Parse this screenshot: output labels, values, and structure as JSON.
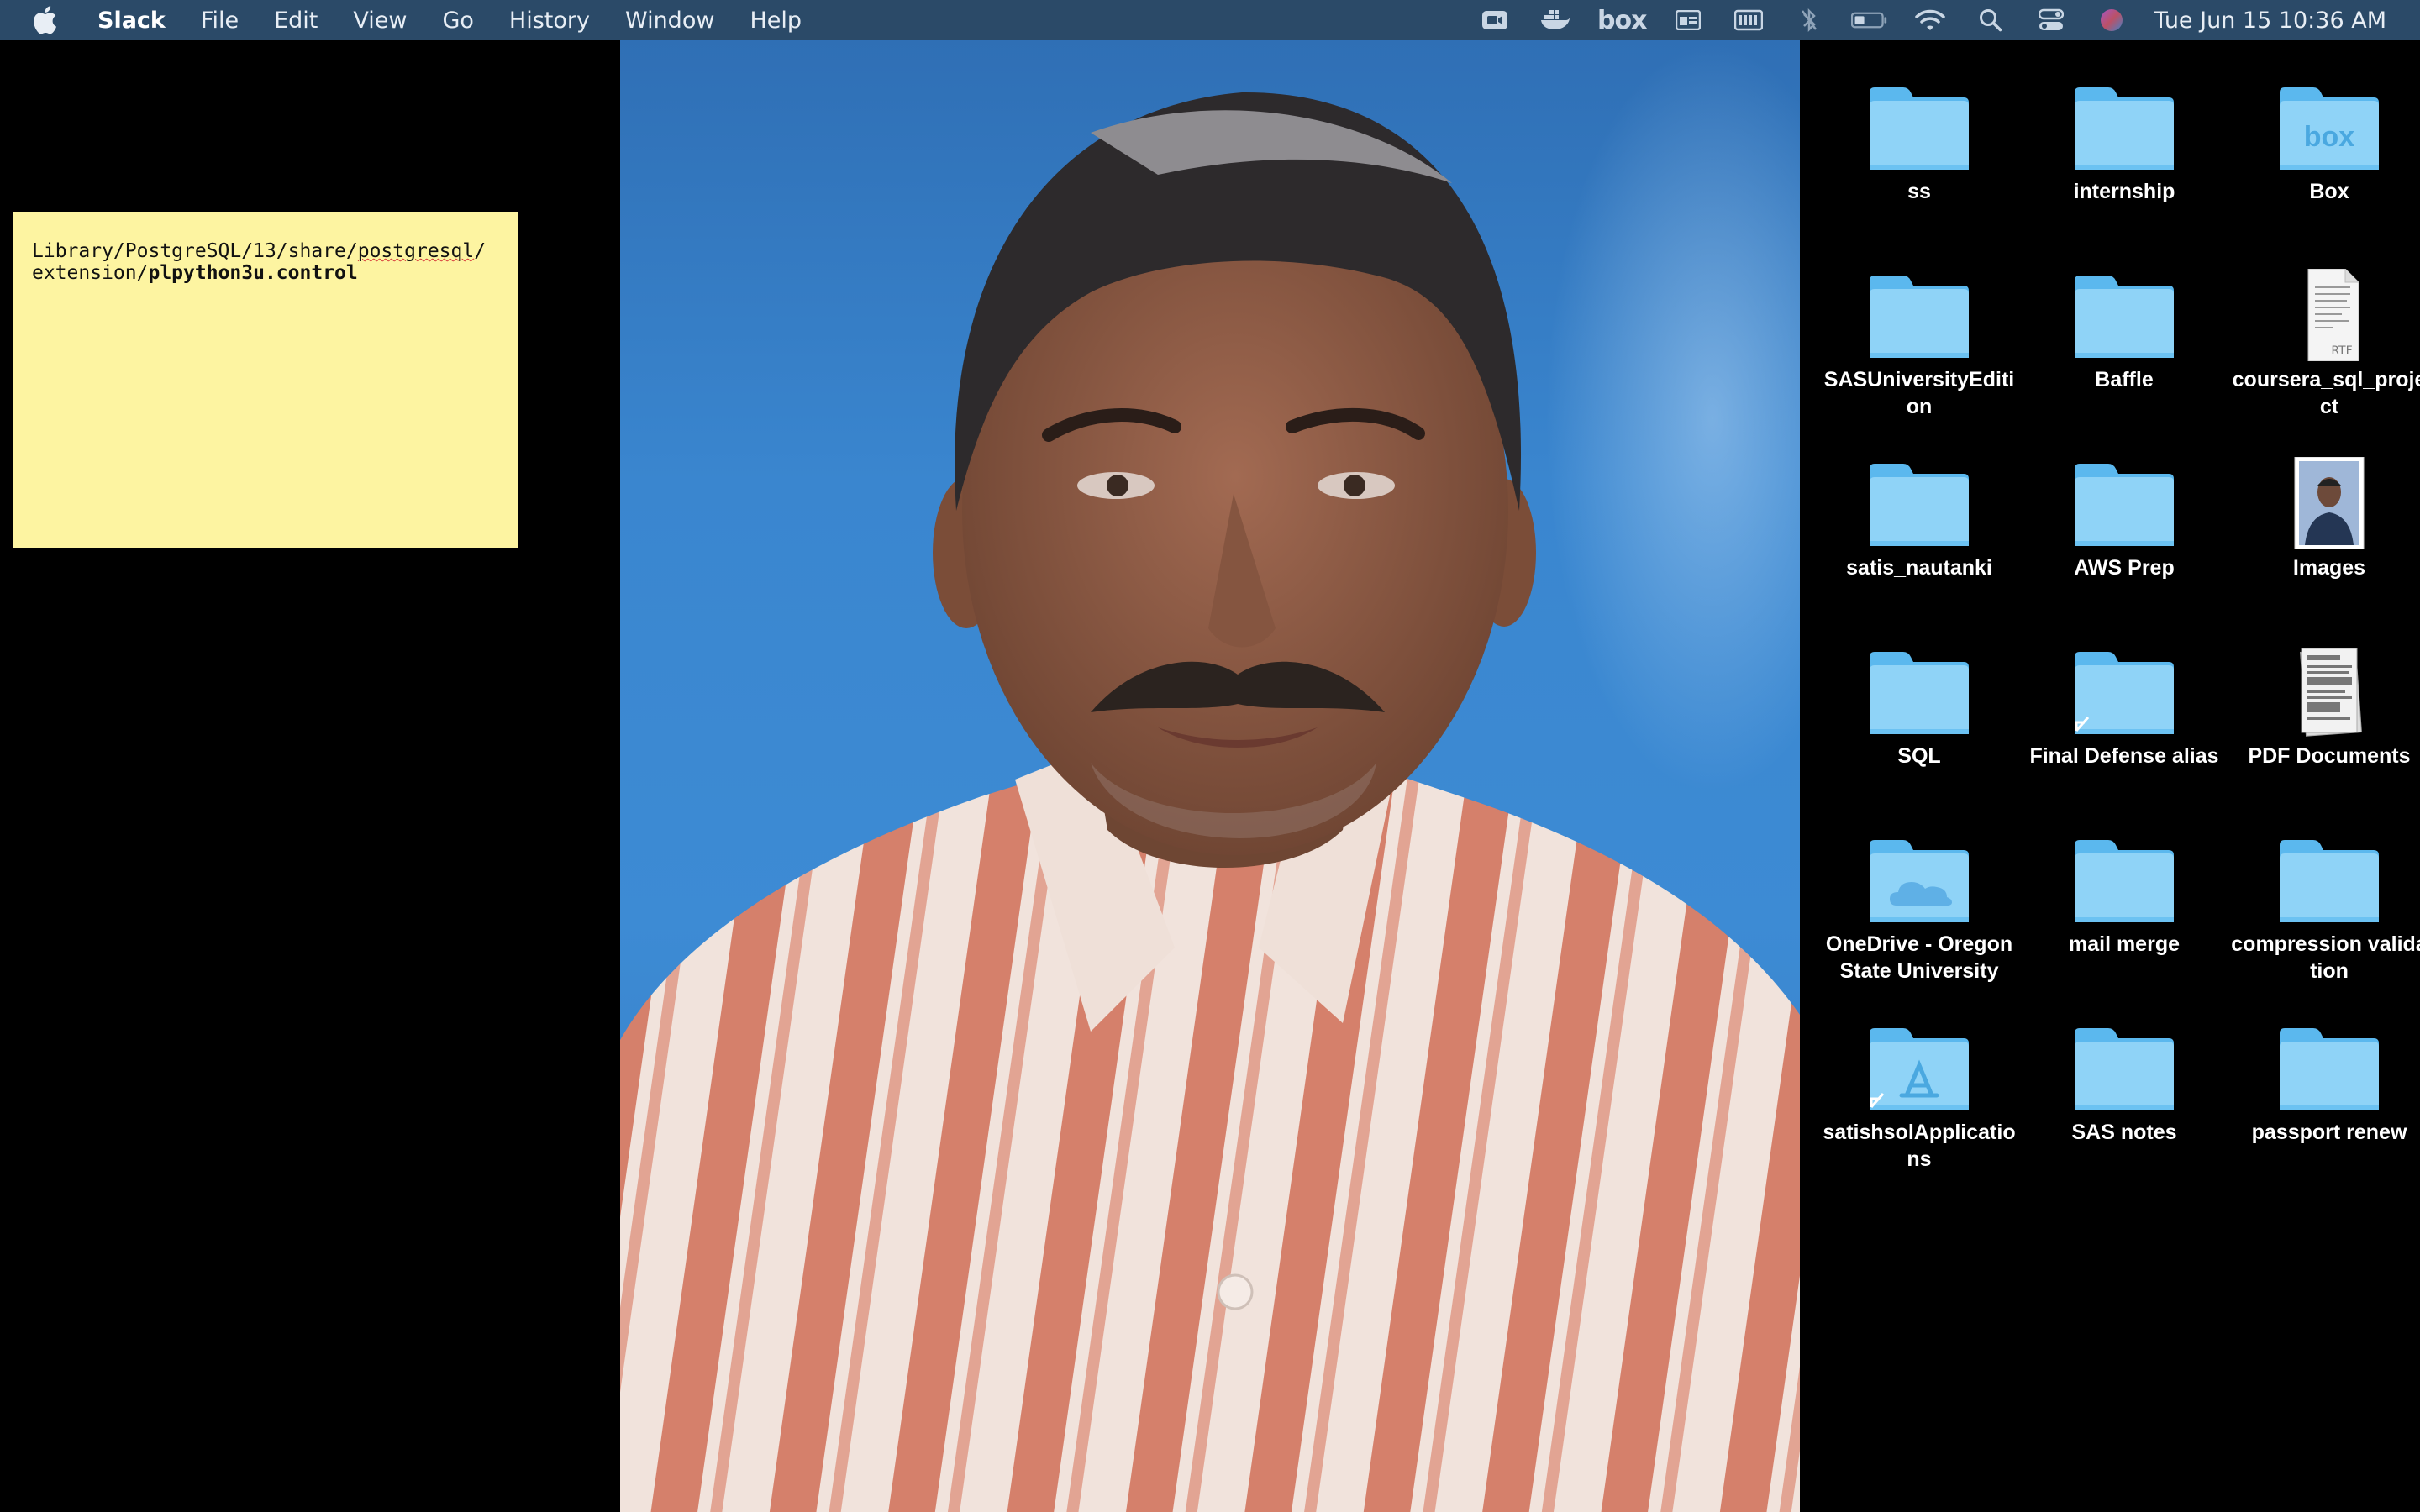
{
  "menubar": {
    "app_name": "Slack",
    "items": [
      "File",
      "Edit",
      "View",
      "Go",
      "History",
      "Window",
      "Help"
    ],
    "status_icons": [
      "video-icon",
      "docker-icon",
      "box-icon",
      "app-window-icon",
      "keyboard-icon",
      "bluetooth-icon",
      "battery-icon",
      "wifi-icon",
      "spotlight-search-icon",
      "control-center-icon",
      "siri-icon"
    ],
    "box_label": "box",
    "clock": "Tue Jun 15  10:36 AM"
  },
  "sticky_note": {
    "line1_a": "Library/PostgreSQL/13/share/",
    "line1_b": "postgresql",
    "line1_c": "/",
    "line2_a": "extension/",
    "line2_b": "plpython3u.control"
  },
  "desktop": {
    "items": [
      {
        "label": "ss",
        "type": "folder"
      },
      {
        "label": "internship",
        "type": "folder"
      },
      {
        "label": "Box",
        "type": "box-folder"
      },
      {
        "label": "SASUniversityEdition",
        "type": "folder"
      },
      {
        "label": "Baffle",
        "type": "folder"
      },
      {
        "label": "coursera_sql_project",
        "type": "rtf-document"
      },
      {
        "label": "satis_nautanki",
        "type": "folder"
      },
      {
        "label": "AWS Prep",
        "type": "folder"
      },
      {
        "label": "Images",
        "type": "photo"
      },
      {
        "label": "SQL",
        "type": "folder"
      },
      {
        "label": "Final Defense alias",
        "type": "folder-alias"
      },
      {
        "label": "PDF Documents",
        "type": "pdf-stack"
      },
      {
        "label": "OneDrive - Oregon State University",
        "type": "onedrive-folder"
      },
      {
        "label": "mail merge",
        "type": "folder"
      },
      {
        "label": "compression validation",
        "type": "folder"
      },
      {
        "label": "satishsolApplications",
        "type": "apps-folder-alias"
      },
      {
        "label": "SAS notes",
        "type": "folder"
      },
      {
        "label": "passport renew",
        "type": "folder"
      }
    ]
  },
  "colors": {
    "menubar_bg": "#2b4a68",
    "folder_light": "#8fd3f7",
    "folder_dark": "#5bb8ee",
    "sticky_bg": "#fdf4a1",
    "photo_bg": "#3a86cf"
  }
}
